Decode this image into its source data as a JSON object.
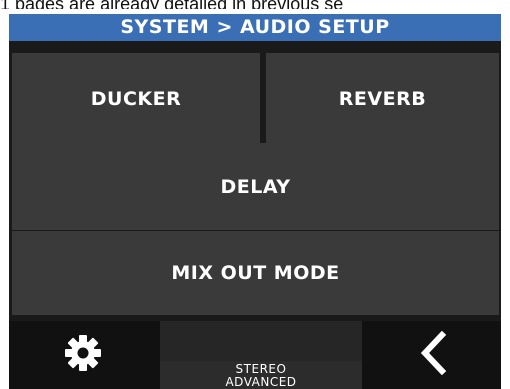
{
  "caption": {
    "text": "1 pages are already detailed in previous se"
  },
  "header": {
    "title": "SYSTEM > AUDIO SETUP"
  },
  "menu": {
    "ducker_label": "DUCKER",
    "reverb_label": "REVERB",
    "delay_label": "DELAY",
    "mix_out_mode_label": "MIX OUT MODE"
  },
  "footer": {
    "mode_line1": "STEREO",
    "mode_line2": "ADVANCED"
  },
  "icons": {
    "settings": "gear-icon",
    "back": "chevron-left-icon"
  },
  "colors": {
    "title_bar": "#3a6fb5",
    "button_bg": "#3a3a3b",
    "panel_bg": "#1a1a1a"
  }
}
